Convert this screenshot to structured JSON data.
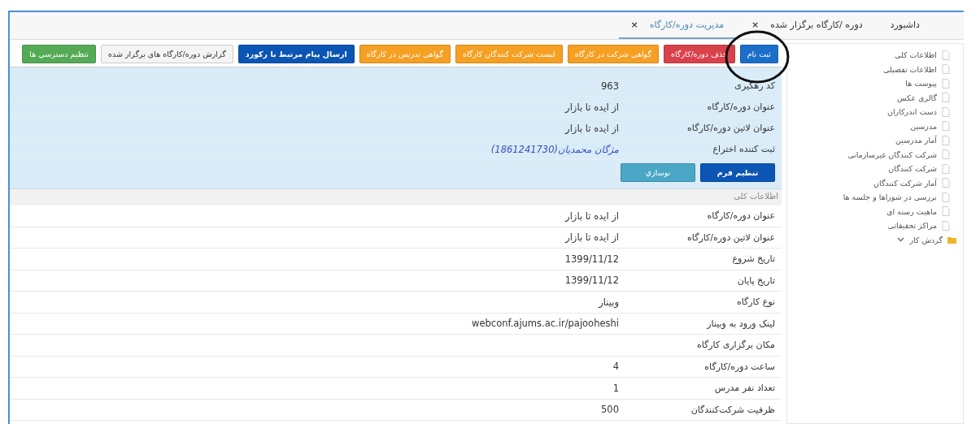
{
  "tabs": [
    {
      "label": "داشبورد",
      "selected": false
    },
    {
      "label": "دوره /کارگاه برگزار شده",
      "selected": false,
      "close": "×"
    },
    {
      "label": "مدیریت دوره/کارگاه",
      "selected": true,
      "close": "×"
    }
  ],
  "sidebar": {
    "items": [
      {
        "label": "اطلاعات کلی",
        "kind": "file"
      },
      {
        "label": "اطلاعات تفصیلی",
        "kind": "file"
      },
      {
        "label": "پیوست ها",
        "kind": "file"
      },
      {
        "label": "گالری عکس",
        "kind": "file"
      },
      {
        "label": "دست اندرکاران",
        "kind": "file"
      },
      {
        "label": "مدرسین",
        "kind": "file"
      },
      {
        "label": "آمار مدرسین",
        "kind": "file"
      },
      {
        "label": "شرکت کنندگان غیرسازمانی",
        "kind": "file"
      },
      {
        "label": "شرکت کنندگان",
        "kind": "file"
      },
      {
        "label": "آمار شرکت کنندگان",
        "kind": "file"
      },
      {
        "label": "بررسی در شوراها و جلسه ها",
        "kind": "file"
      },
      {
        "label": "ماهیت رسته ای",
        "kind": "file"
      },
      {
        "label": "مراکز تحقیقاتی",
        "kind": "file"
      },
      {
        "label": "گردش کار",
        "kind": "folder"
      }
    ]
  },
  "toolbar": [
    {
      "label": "ثبت نام",
      "kind": "primary"
    },
    {
      "label": "حذف دوره/کارگاه",
      "kind": "danger"
    },
    {
      "label": "گواهي شرکت در کارگاه",
      "kind": "warning"
    },
    {
      "label": "ليست شرکت کنندگان کارگاه",
      "kind": "warning"
    },
    {
      "label": "گواهي تدريس در کارگاه",
      "kind": "warning"
    },
    {
      "label": "ارسال پيام مرتبط با رکورد",
      "kind": "dark"
    },
    {
      "label": "گزارش دوره/کارگاه های برگزار شده",
      "kind": "default"
    },
    {
      "label": "تنظيم دسترسي ها",
      "kind": "success"
    }
  ],
  "summary": {
    "fields": [
      {
        "label": "کد رهگیری",
        "value": "963",
        "kind": "text"
      },
      {
        "label": "عنوان دوره/کارگاه",
        "value": "از ایده تا بازار",
        "kind": "text"
      },
      {
        "label": "عنوان لاتین دوره/کارگاه",
        "value": "از ایده تا بازار",
        "kind": "text"
      },
      {
        "label": "ثبت کننده اختراع",
        "value": "مژگان محمدیان(1861241730)",
        "kind": "link"
      }
    ],
    "buttons": [
      {
        "label": "تنظیم فرم",
        "kind": "dark"
      },
      {
        "label": "نوسازي",
        "kind": "info"
      }
    ]
  },
  "details": {
    "title": "اطلاعات کلی",
    "rows": [
      {
        "label": "عنوان دوره/کارگاه",
        "value": "از ایده تا بازار"
      },
      {
        "label": "عنوان لاتین دوره/کارگاه",
        "value": "از ایده تا بازار"
      },
      {
        "label": "تاریخ شروع",
        "value": "1399/11/12"
      },
      {
        "label": "تاریخ پایان",
        "value": "1399/11/12"
      },
      {
        "label": "نوع کارگاه",
        "value": "وبینار"
      },
      {
        "label": "لینک ورود به وبینار",
        "value": "webconf.ajums.ac.ir/pajooheshi"
      },
      {
        "label": "مکان برگزاری کارگاه"
      },
      {
        "label": "ساعت دوره/کارگاه",
        "value": "4"
      },
      {
        "label": "تعداد نفر مدرس",
        "value": "1"
      },
      {
        "label": "ظرفیت شرکت‌کنندگان",
        "value": "500"
      }
    ]
  }
}
